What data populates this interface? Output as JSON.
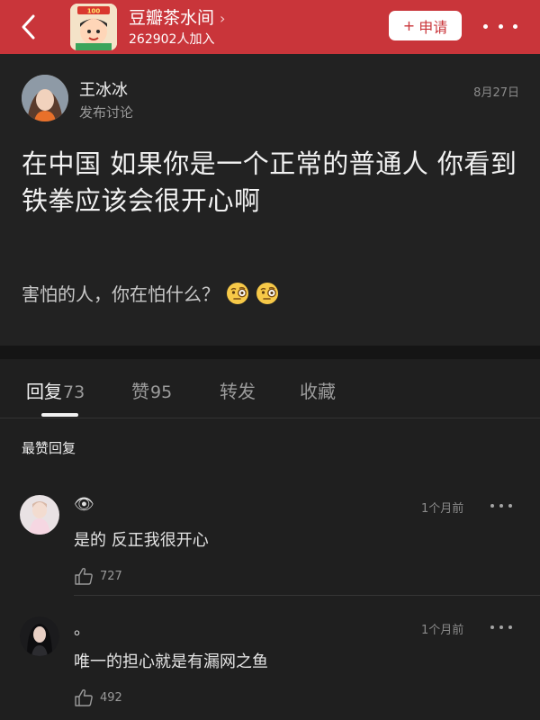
{
  "header": {
    "group_name": "豆瓣茶水间",
    "chevron": "›",
    "members": "262902人加入",
    "join_plus": "+",
    "join_label": "申请",
    "logo_icon": "douban-teahouse-logo",
    "back_icon": "back-chevron-icon",
    "more_icon": "more-dots-icon",
    "bar_color": "#c9353a"
  },
  "post": {
    "author_name": "王冰冰",
    "post_type": "发布讨论",
    "date": "8月27日",
    "title": "在中国 如果你是一个正常的普通人 你看到铁拳应该会很开心啊",
    "body": "害怕的人，你在怕什么？",
    "body_emojis": [
      "monocle-face-emoji",
      "monocle-face-emoji"
    ]
  },
  "tabs": [
    {
      "label": "回复",
      "count": "73",
      "active": true
    },
    {
      "label": "赞",
      "count": "95",
      "active": false
    },
    {
      "label": "转发",
      "count": "",
      "active": false
    },
    {
      "label": "收藏",
      "count": "",
      "active": false
    }
  ],
  "section_label": "最赞回复",
  "comments": [
    {
      "name": "👁",
      "time": "1个月前",
      "text": "是的 反正我很开心",
      "likes": "727",
      "avatar_icon": "user-avatar"
    },
    {
      "name": "。",
      "time": "1个月前",
      "text": "唯一的担心就是有漏网之鱼",
      "likes": "492",
      "avatar_icon": "user-avatar"
    }
  ],
  "colors": {
    "accent": "#c9353a",
    "background": "#1f1f1f",
    "post_background": "#222222"
  }
}
